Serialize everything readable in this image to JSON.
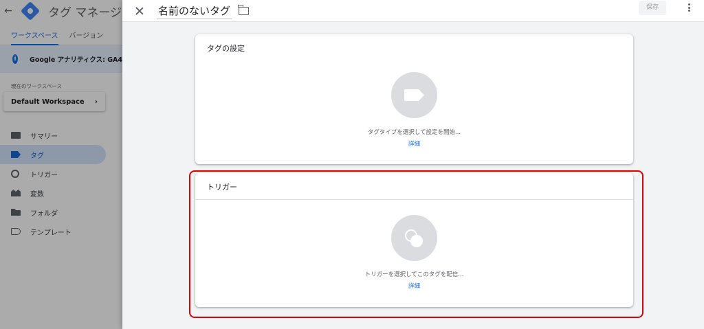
{
  "app": {
    "title": "タグ マネージャー",
    "tabs": [
      "ワークスペース",
      "バージョン"
    ],
    "banner_text": "Google アナリティクス: GA4",
    "workspace_label": "現在のワークスペース",
    "workspace_name": "Default Workspace",
    "nav": [
      {
        "label": "サマリー",
        "icon": "summary-icon"
      },
      {
        "label": "タグ",
        "icon": "tag-icon",
        "active": true
      },
      {
        "label": "トリガー",
        "icon": "trigger-icon"
      },
      {
        "label": "変数",
        "icon": "variables-icon"
      },
      {
        "label": "フォルダ",
        "icon": "folder-icon"
      },
      {
        "label": "テンプレート",
        "icon": "template-icon"
      }
    ]
  },
  "panel": {
    "tag_name": "名前のないタグ",
    "save_label": "保存",
    "tag_config": {
      "title": "タグの設定",
      "hint": "タグタイプを選択して設定を開始...",
      "link": "詳細"
    },
    "trigger": {
      "title": "トリガー",
      "hint": "トリガーを選択してこのタグを配信...",
      "link": "詳細"
    }
  },
  "colors": {
    "accent": "#1a73e8",
    "highlight_box": "#e00000",
    "placeholder_circle": "#dadce0"
  }
}
